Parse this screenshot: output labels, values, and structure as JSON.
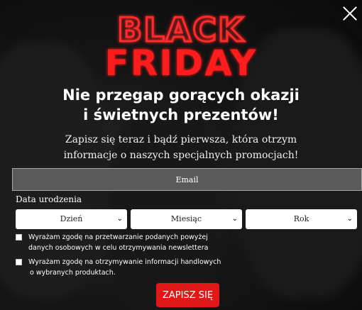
{
  "modal": {
    "logo_line1": "BLACK",
    "logo_line2": "FRIDAY",
    "headline_line1": "Nie przegap gorących okazji",
    "headline_line2": "i świetnych prezentów!",
    "sub_line1": "Zapisz się teraz i bądź pierwsza, która otrzym",
    "sub_line2": "informacje o naszych specjalnych promocjach!",
    "email_placeholder": "Email",
    "dob_label": "Data urodzenia",
    "day_select": "Dzień",
    "month_select": "Miesiąc",
    "year_select": "Rok",
    "consent1_line1": "Wyrażam zgodę na przetwarzanie podanych powyżej",
    "consent1_line2": "danych osobowych w celu otrzymywania newslettera",
    "consent2_line1": "Wyrażam zgodę na otrzymywanie informacji handlowych",
    "consent2_line2": "o wybranych produktach.",
    "submit_label": "ZAPISZ SIĘ"
  },
  "colors": {
    "accent": "#e21818",
    "background": "#111111"
  },
  "icons": {
    "close": "close-icon",
    "chevron": "chevron-down-icon"
  }
}
